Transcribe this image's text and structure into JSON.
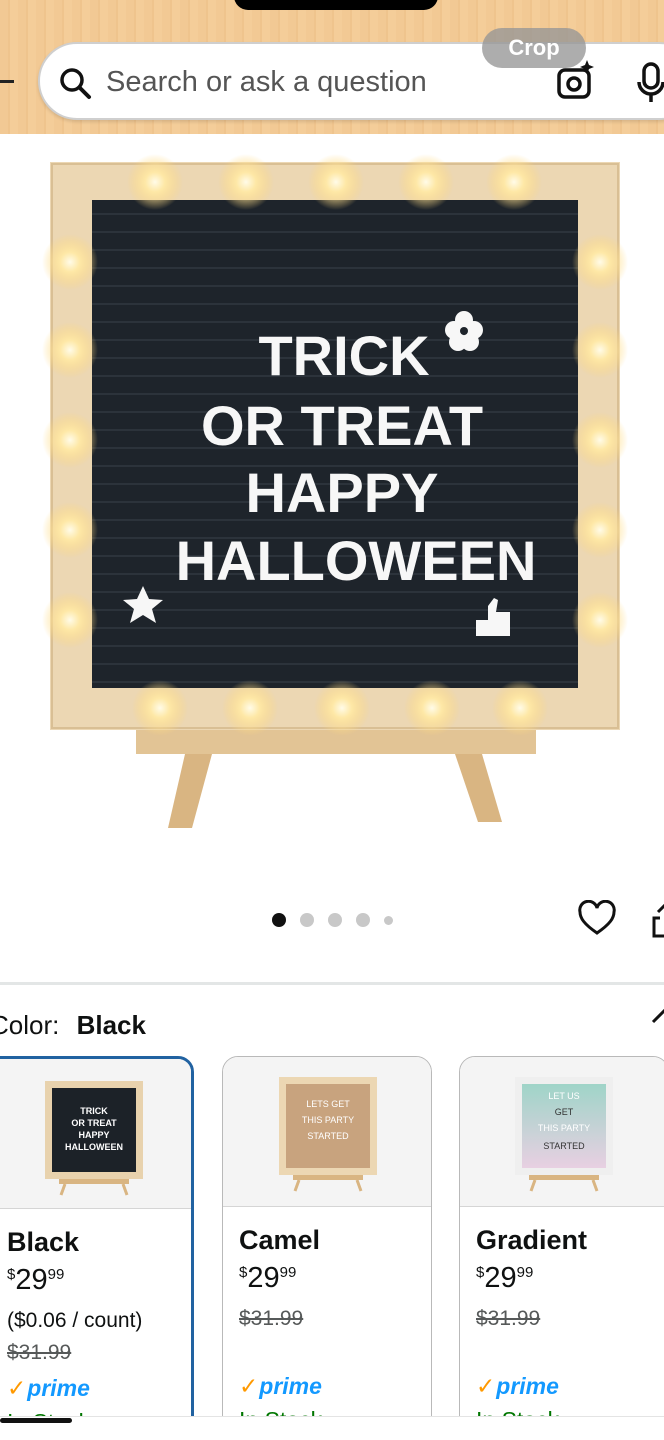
{
  "header": {
    "search_placeholder": "Search or ask a question",
    "crop_label": "Crop",
    "icons": [
      "search-icon",
      "camera-icon",
      "mic-icon"
    ],
    "background_color": "#f2c994"
  },
  "product_image": {
    "sign_lines": [
      "TRICK",
      "OR TREAT",
      "HAPPY",
      "HALLOWEEN"
    ],
    "carousel_total": 5,
    "carousel_active_index": 1
  },
  "actions": {
    "icons": [
      "heart-icon",
      "share-icon"
    ]
  },
  "color_selector": {
    "label": "Color:",
    "selected_value": "Black"
  },
  "swatches": [
    {
      "name": "Black",
      "price_symbol": "$",
      "price_whole": "29",
      "price_fraction": "99",
      "unit_price": "($0.06 / count)",
      "list_price": "$31.99",
      "prime": "prime",
      "stock": "In Stock",
      "thumb_lines": [
        "TRICK",
        "OR TREAT",
        "HAPPY",
        "HALLOWEEN"
      ],
      "thumb_color": "#1c2228"
    },
    {
      "name": "Camel",
      "price_symbol": "$",
      "price_whole": "29",
      "price_fraction": "99",
      "list_price": "$31.99",
      "prime": "prime",
      "stock": "In Stock",
      "thumb_lines": [
        "LETS GET",
        "THIS PARTY",
        "STARTED"
      ],
      "thumb_color": "#c8a37e"
    },
    {
      "name": "Gradient",
      "price_symbol": "$",
      "price_whole": "29",
      "price_fraction": "99",
      "list_price": "$31.99",
      "prime": "prime",
      "stock": "In Stock",
      "thumb_lines": [
        "LET US",
        "GET",
        "THIS PARTY",
        "STARTED"
      ],
      "thumb_color": "#9fd4c8"
    }
  ],
  "colors": {
    "selected_border": "#2162a1",
    "prime_blue": "#1399ff",
    "prime_check": "#ff9900",
    "in_stock": "#007600"
  }
}
